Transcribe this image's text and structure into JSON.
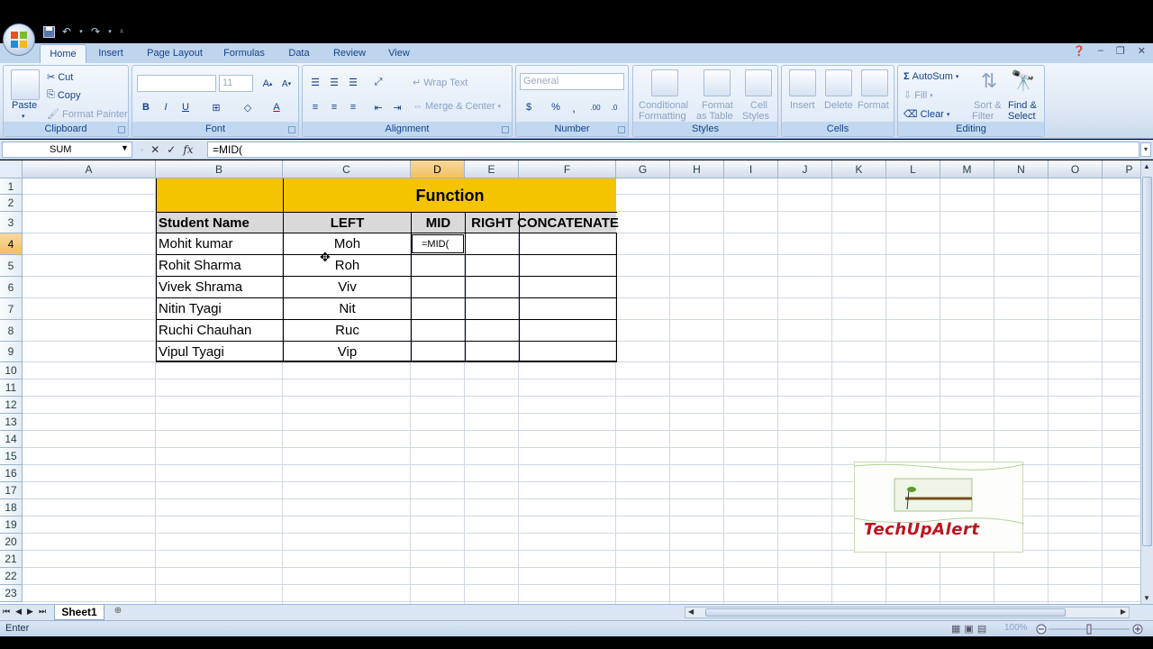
{
  "ribbon": {
    "tabs": [
      "Home",
      "Insert",
      "Page Layout",
      "Formulas",
      "Data",
      "Review",
      "View"
    ],
    "active_tab": "Home",
    "clipboard": {
      "title": "Clipboard",
      "paste": "Paste",
      "cut": "Cut",
      "copy": "Copy",
      "format_painter": "Format Painter"
    },
    "font": {
      "title": "Font",
      "font_size": "11",
      "bold": "B",
      "italic": "I",
      "underline": "U"
    },
    "alignment": {
      "title": "Alignment",
      "wrap_text": "Wrap Text",
      "merge_center": "Merge & Center"
    },
    "number": {
      "title": "Number",
      "format": "General",
      "currency": "$",
      "percent": "%"
    },
    "styles": {
      "title": "Styles",
      "conditional": "Conditional",
      "formatting": "Formatting",
      "format": "Format",
      "as_table": "as Table",
      "cell": "Cell",
      "cell_styles": "Styles"
    },
    "cells": {
      "title": "Cells",
      "insert": "Insert",
      "delete": "Delete",
      "format": "Format"
    },
    "editing": {
      "title": "Editing",
      "autosum": "AutoSum",
      "fill": "Fill",
      "clear": "Clear",
      "sort": "Sort &",
      "filter": "Filter",
      "find": "Find &",
      "select": "Select"
    }
  },
  "formula_bar": {
    "name_box": "SUM",
    "fx": "fx",
    "formula": "=MID("
  },
  "columns": [
    "A",
    "B",
    "C",
    "D",
    "E",
    "F",
    "G",
    "H",
    "I",
    "J",
    "K",
    "L",
    "M",
    "N",
    "O",
    "P"
  ],
  "rows": [
    "1",
    "2",
    "3",
    "4",
    "5",
    "6",
    "7",
    "8",
    "9",
    "10",
    "11",
    "12",
    "13",
    "14",
    "15",
    "16",
    "17",
    "18",
    "19",
    "20",
    "21",
    "22",
    "23"
  ],
  "table": {
    "title": "Function",
    "headers": [
      "Student Name",
      "LEFT",
      "MID",
      "RIGHT",
      "CONCATENATE"
    ],
    "rows": [
      {
        "name": "Mohit kumar",
        "left": "Moh",
        "mid": "=MID("
      },
      {
        "name": "Rohit Sharma",
        "left": "Roh",
        "mid": ""
      },
      {
        "name": "Vivek Shrama",
        "left": "Viv",
        "mid": ""
      },
      {
        "name": "Nitin Tyagi",
        "left": "Nit",
        "mid": ""
      },
      {
        "name": "Ruchi Chauhan",
        "left": "Ruc",
        "mid": ""
      },
      {
        "name": "Vipul Tyagi",
        "left": "Vip",
        "mid": ""
      }
    ],
    "title_fill": "#f5c400",
    "header_fill": "#d9d9d9"
  },
  "sheet_tab": "Sheet1",
  "status": {
    "mode": "Enter",
    "zoom": "100%"
  },
  "watermark": {
    "text": "TechUpAlert"
  }
}
